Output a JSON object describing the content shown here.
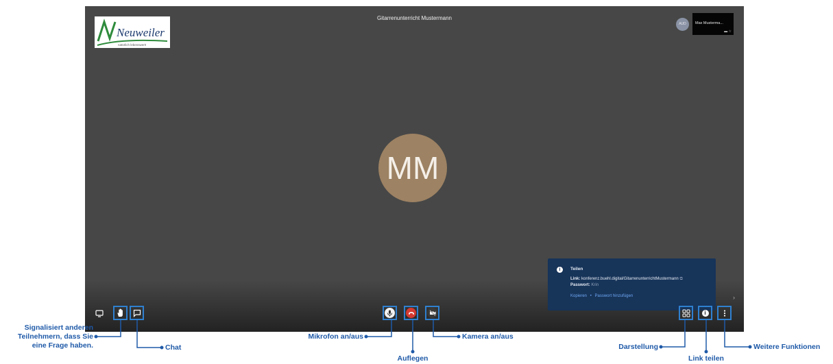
{
  "conference": {
    "title": "Gitarrenunterricht Mustermann",
    "logo_text": "Neuweiler",
    "logo_tagline": "natürlich lebenswert!",
    "self_avatar": "AUD",
    "big_avatar_initials": "MM"
  },
  "thumbnail": {
    "name": "Max Musterma...",
    "icons": "▬ ☆"
  },
  "share_panel": {
    "title": "Teilen",
    "link_label": "Link:",
    "link_value": "konferenz.buehl.digital/GitarrenunterrichtMustermann",
    "password_label": "Passwort:",
    "password_value": "Krin",
    "copy_action": "Kopieren",
    "separator": "•",
    "add_password_action": "Passwort hinzufügen"
  },
  "toolbar": {
    "left": [
      "screen-share-icon",
      "raise-hand-icon",
      "chat-icon"
    ],
    "center": [
      "microphone-icon",
      "hangup-icon",
      "camera-off-icon"
    ],
    "right": [
      "tile-view-icon",
      "info-icon",
      "more-vertical-icon"
    ]
  },
  "callouts": {
    "raise_hand": [
      "Signalisiert anderen",
      "Teilnehmern, dass Sie",
      "eine Frage haben."
    ],
    "chat": "Chat",
    "microphone": "Mikrofon an/aus",
    "hangup": "Auflegen",
    "camera": "Kamera an/aus",
    "layout": "Darstellung",
    "share_link": "Link teilen",
    "more": "Weitere Funktionen"
  },
  "colors": {
    "stage": "#474747",
    "accent_blue": "#2f80d0",
    "callout_blue": "#1f5aa8",
    "hangup_red": "#d63a31",
    "avatar": "#9d8263",
    "share_panel": "#173459"
  }
}
